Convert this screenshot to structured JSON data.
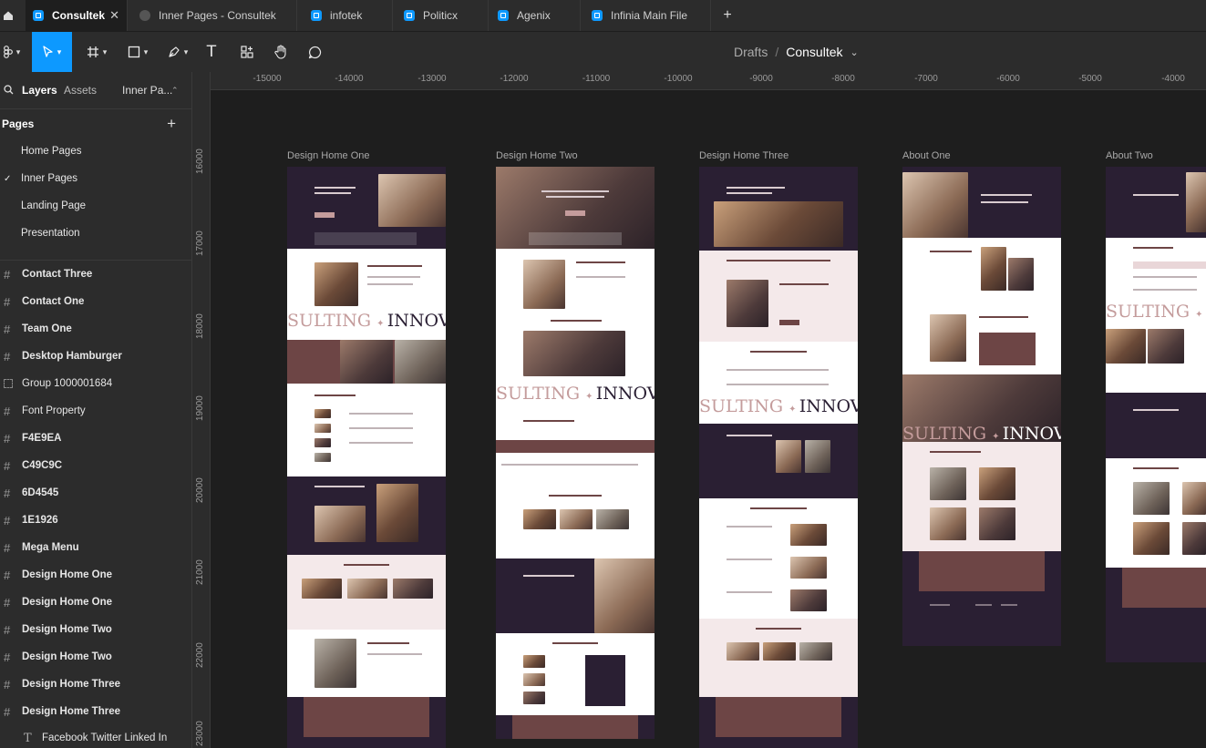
{
  "tabs": [
    {
      "label": "Consultek",
      "active": true,
      "close": "✕"
    },
    {
      "label": "Inner Pages - Consultek",
      "active": false
    },
    {
      "label": "infotek",
      "active": false
    },
    {
      "label": "Politicx",
      "active": false
    },
    {
      "label": "Agenix",
      "active": false
    },
    {
      "label": "Infinia Main File",
      "active": false
    }
  ],
  "new_tab": "+",
  "toolbar": {
    "breadcrumb_parent": "Drafts",
    "breadcrumb_sep": "/",
    "breadcrumb_current": "Consultek",
    "breadcrumb_chevron": "⌄",
    "text_tool": "T",
    "tools": [
      "main-menu-icon",
      "move-icon",
      "frame-icon",
      "rectangle-icon",
      "pen-icon",
      "text-icon",
      "resources-icon",
      "hand-icon",
      "comment-icon"
    ]
  },
  "left_panel": {
    "tab_layers": "Layers",
    "tab_assets": "Assets",
    "page_selector": "Inner Pa...",
    "page_selector_chev": "⌃",
    "pages_title": "Pages",
    "add_page": "+",
    "pages": [
      {
        "label": "Home Pages",
        "current": false
      },
      {
        "label": "Inner Pages",
        "current": true,
        "check": "✓"
      },
      {
        "label": "Landing Page",
        "current": false
      },
      {
        "label": "Presentation",
        "current": false
      }
    ],
    "layers": [
      {
        "label": "Contact Three",
        "type": "frame"
      },
      {
        "label": "Contact One",
        "type": "frame"
      },
      {
        "label": "Team One",
        "type": "frame"
      },
      {
        "label": "Desktop Hamburger",
        "type": "frame"
      },
      {
        "label": "Group 1000001684",
        "type": "group"
      },
      {
        "label": "Font Property",
        "type": "frame"
      },
      {
        "label": "F4E9EA",
        "type": "frame"
      },
      {
        "label": "C49C9C",
        "type": "frame"
      },
      {
        "label": "6D4545",
        "type": "frame"
      },
      {
        "label": "1E1926",
        "type": "frame"
      },
      {
        "label": "Mega Menu",
        "type": "frame"
      },
      {
        "label": "Design Home One",
        "type": "frame"
      },
      {
        "label": "Design Home One",
        "type": "frame"
      },
      {
        "label": "Design Home Two",
        "type": "frame"
      },
      {
        "label": "Design Home Two",
        "type": "frame"
      },
      {
        "label": "Design Home Three",
        "type": "frame"
      },
      {
        "label": "Design Home Three",
        "type": "frame"
      },
      {
        "label": "Facebook Twitter Linked In",
        "type": "text",
        "icon": "T"
      }
    ]
  },
  "canvas": {
    "ruler_top": [
      "-15000",
      "-14000",
      "-13000",
      "-12000",
      "-11000",
      "-10000",
      "-9000",
      "-8000",
      "-7000",
      "-6000",
      "-5000",
      "-4000"
    ],
    "ruler_left": [
      "16000",
      "17000",
      "18000",
      "19000",
      "20000",
      "21000",
      "22000",
      "23000"
    ],
    "frames": [
      {
        "title": "Design Home One",
        "marquee": "SULTING ✦ INNOVAT"
      },
      {
        "title": "Design Home Two",
        "marquee": "SULTING ✦ INNOVAT"
      },
      {
        "title": "Design Home Three",
        "marquee": "SULTING ✦ INNOVAT"
      },
      {
        "title": "About One",
        "marquee": "SULTING ✦ INNOVAT"
      },
      {
        "title": "About Two",
        "marquee": "SULTING ✦ IN"
      }
    ],
    "palette": {
      "light": "#F4E9EA",
      "rose": "#C49C9C",
      "brown": "#6D4545",
      "dark": "#1E1926"
    }
  }
}
